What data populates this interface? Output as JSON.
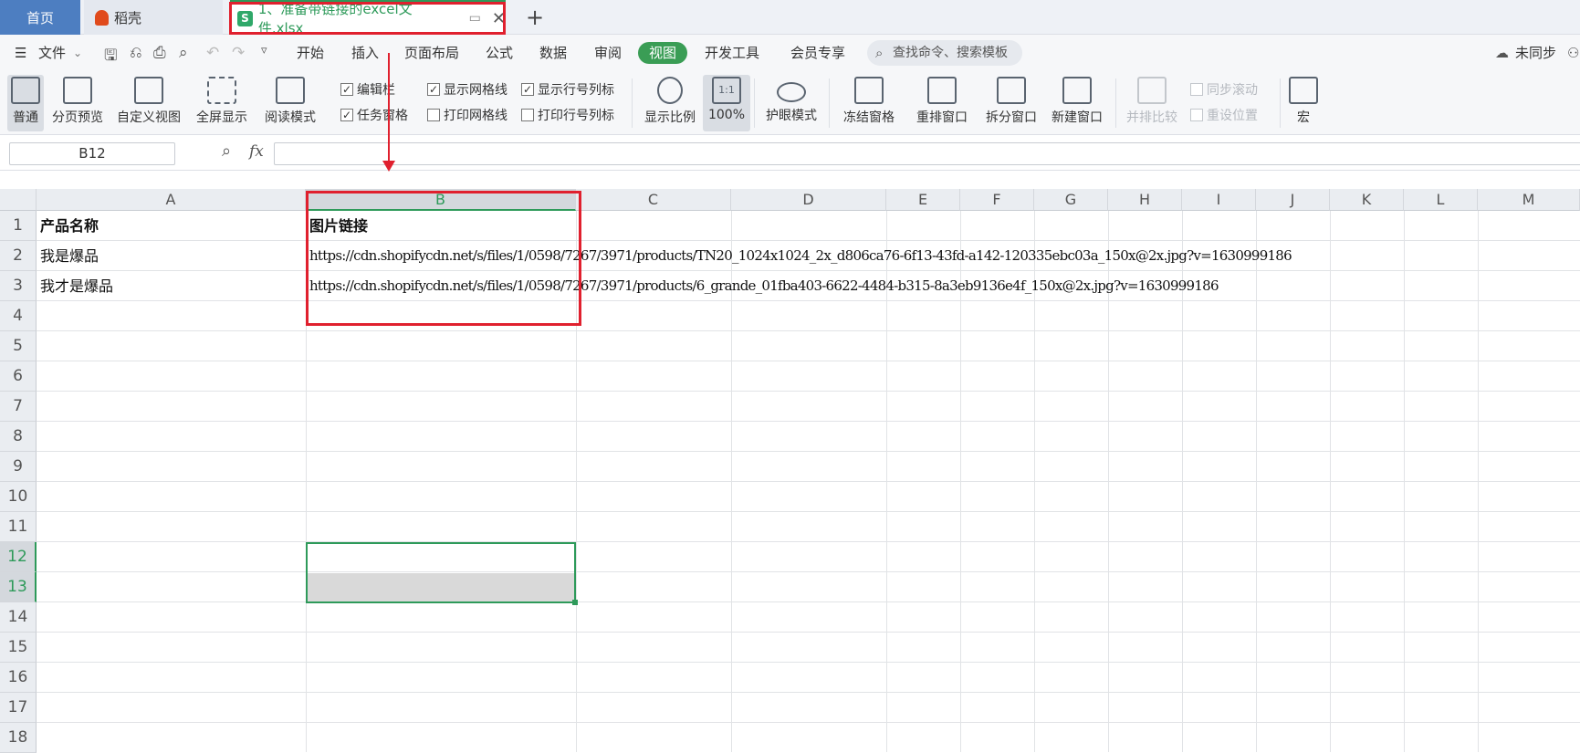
{
  "tabs": {
    "home": "首页",
    "daoke": "稻壳",
    "file": "1、准备带链接的excel文件.xlsx",
    "file_icon": "S",
    "new_tab": "+"
  },
  "menu": {
    "file": "文件",
    "items": [
      "开始",
      "插入",
      "页面布局",
      "公式",
      "数据",
      "审阅",
      "视图",
      "开发工具",
      "会员专享"
    ],
    "active": "视图",
    "search_placeholder": "查找命令、搜索模板",
    "sync": "未同步"
  },
  "ribbon": {
    "normal": "普通",
    "page_preview": "分页预览",
    "custom_view": "自定义视图",
    "fullscreen": "全屏显示",
    "reading_mode": "阅读模式",
    "edit_bar": "编辑栏",
    "task_pane": "任务窗格",
    "show_gridlines": "显示网格线",
    "print_gridlines": "打印网格线",
    "show_headers": "显示行号列标",
    "print_headers": "打印行号列标",
    "zoom_ratio": "显示比例",
    "zoom_100": "100%",
    "zoom_100_icon": "1:1",
    "eye_mode": "护眼模式",
    "freeze": "冻结窗格",
    "rearrange": "重排窗口",
    "split": "拆分窗口",
    "new_window": "新建窗口",
    "side_by_side": "并排比较",
    "sync_scroll": "同步滚动",
    "reset_pos": "重设位置",
    "macro": "宏"
  },
  "formula": {
    "name_box": "B12",
    "fx": "fx",
    "value": ""
  },
  "columns": [
    "A",
    "B",
    "C",
    "D",
    "E",
    "F",
    "G",
    "H",
    "I",
    "J",
    "K",
    "L",
    "M"
  ],
  "rows": [
    "1",
    "2",
    "3",
    "4",
    "5",
    "6",
    "7",
    "8",
    "9",
    "10",
    "11",
    "12",
    "13",
    "14",
    "15",
    "16",
    "17",
    "18"
  ],
  "cells": {
    "A1": "产品名称",
    "B1": "图片链接",
    "A2": "我是爆品",
    "B2": "https://cdn.shopifycdn.net/s/files/1/0598/7267/3971/products/TN20_1024x1024_2x_d806ca76-6f13-43fd-a142-120335ebc03a_150x@2x.jpg?v=1630999186",
    "A3": "我才是爆品",
    "B3": "https://cdn.shopifycdn.net/s/files/1/0598/7267/3971/products/6_grande_01fba403-6622-4484-b315-8a3eb9136e4f_150x@2x.jpg?v=1630999186"
  }
}
